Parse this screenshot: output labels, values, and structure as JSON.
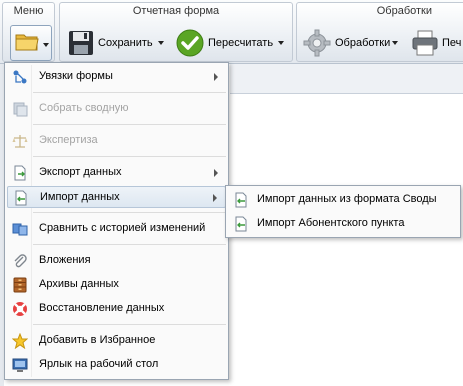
{
  "ribbon": {
    "menu_group_title": "Меню",
    "form_group_title": "Отчетная форма",
    "processing_group_title": "Обработки",
    "save_label": "Сохранить",
    "recalc_label": "Пересчитать",
    "processing_label": "Обработки",
    "print_label": "Печ"
  },
  "menu": {
    "items": [
      {
        "label": "Увязки формы",
        "enabled": true,
        "submenu": true
      },
      {
        "label": "Собрать сводную",
        "enabled": false,
        "submenu": false
      },
      {
        "label": "Экспертиза",
        "enabled": false,
        "submenu": false
      },
      {
        "label": "Экспорт данных",
        "enabled": true,
        "submenu": true
      },
      {
        "label": "Импорт данных",
        "enabled": true,
        "submenu": true,
        "active": true
      },
      {
        "label": "Сравнить с историей изменений",
        "enabled": true,
        "submenu": false
      },
      {
        "label": "Вложения",
        "enabled": true,
        "submenu": false
      },
      {
        "label": "Архивы данных",
        "enabled": true,
        "submenu": false
      },
      {
        "label": "Восстановление данных",
        "enabled": true,
        "submenu": false
      },
      {
        "label": "Добавить в Избранное",
        "enabled": true,
        "submenu": false
      },
      {
        "label": "Ярлык на рабочий стол",
        "enabled": true,
        "submenu": false
      }
    ]
  },
  "submenu": {
    "items": [
      {
        "label": "Импорт данных из формата Своды"
      },
      {
        "label": "Импорт Абонентского пункта"
      }
    ]
  },
  "colors": {
    "accent_green": "#5aa524",
    "disabled_text": "#a3a3a3",
    "active_bg": "#dde7f1"
  }
}
